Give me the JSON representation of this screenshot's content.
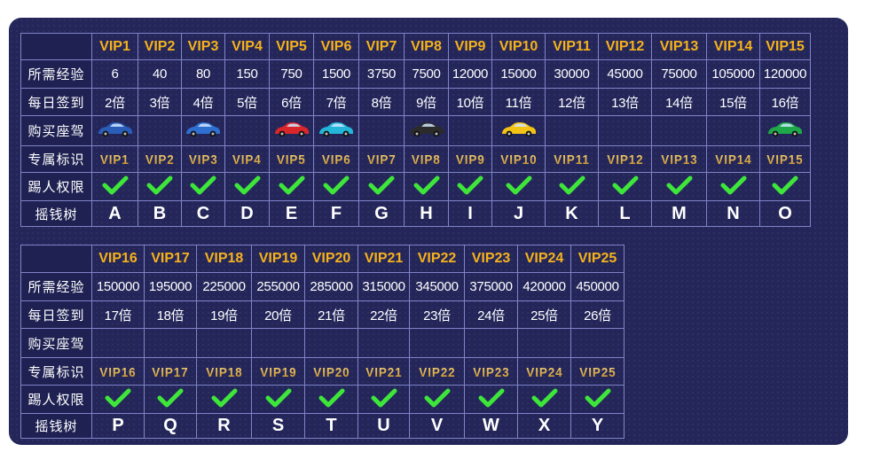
{
  "row_labels": {
    "exp": "所需经验",
    "sign": "每日签到",
    "car": "购买座驾",
    "badge": "专属标识",
    "kick": "踢人权限",
    "tree": "摇钱树"
  },
  "colors": {
    "panel": "#24265a",
    "grid": "#7e83c6",
    "level": "#f6b21b",
    "check": "#3ee63a"
  },
  "tier1": [
    {
      "level": "VIP1",
      "exp": "6",
      "sign": "2倍",
      "car": "blue-sedan",
      "badge": "VIP1",
      "kick": true,
      "tree": "A"
    },
    {
      "level": "VIP2",
      "exp": "40",
      "sign": "3倍",
      "car": "",
      "badge": "VIP2",
      "kick": true,
      "tree": "B"
    },
    {
      "level": "VIP3",
      "exp": "80",
      "sign": "4倍",
      "car": "blue-suv",
      "badge": "VIP3",
      "kick": true,
      "tree": "C"
    },
    {
      "level": "VIP4",
      "exp": "150",
      "sign": "5倍",
      "car": "",
      "badge": "VIP4",
      "kick": true,
      "tree": "D"
    },
    {
      "level": "VIP5",
      "exp": "750",
      "sign": "6倍",
      "car": "red-sports-car",
      "badge": "VIP5",
      "kick": true,
      "tree": "E"
    },
    {
      "level": "VIP6",
      "exp": "1500",
      "sign": "7倍",
      "car": "cyan-sports-car",
      "badge": "VIP6",
      "kick": true,
      "tree": "F"
    },
    {
      "level": "VIP7",
      "exp": "3750",
      "sign": "8倍",
      "car": "",
      "badge": "VIP7",
      "kick": true,
      "tree": "G"
    },
    {
      "level": "VIP8",
      "exp": "7500",
      "sign": "9倍",
      "car": "black-sedan",
      "badge": "VIP8",
      "kick": true,
      "tree": "H"
    },
    {
      "level": "VIP9",
      "exp": "12000",
      "sign": "10倍",
      "car": "",
      "badge": "VIP9",
      "kick": true,
      "tree": "I"
    },
    {
      "level": "VIP10",
      "exp": "15000",
      "sign": "11倍",
      "car": "yellow-supercar",
      "badge": "VIP10",
      "kick": true,
      "tree": "J"
    },
    {
      "level": "VIP11",
      "exp": "30000",
      "sign": "12倍",
      "car": "",
      "badge": "VIP11",
      "kick": true,
      "tree": "K"
    },
    {
      "level": "VIP12",
      "exp": "45000",
      "sign": "13倍",
      "car": "",
      "badge": "VIP12",
      "kick": true,
      "tree": "L"
    },
    {
      "level": "VIP13",
      "exp": "75000",
      "sign": "14倍",
      "car": "",
      "badge": "VIP13",
      "kick": true,
      "tree": "M"
    },
    {
      "level": "VIP14",
      "exp": "105000",
      "sign": "15倍",
      "car": "",
      "badge": "VIP14",
      "kick": true,
      "tree": "N"
    },
    {
      "level": "VIP15",
      "exp": "120000",
      "sign": "16倍",
      "car": "green-supercar",
      "badge": "VIP15",
      "kick": true,
      "tree": "O"
    }
  ],
  "tier2": [
    {
      "level": "VIP16",
      "exp": "150000",
      "sign": "17倍",
      "badge": "VIP16",
      "kick": true,
      "tree": "P"
    },
    {
      "level": "VIP17",
      "exp": "195000",
      "sign": "18倍",
      "badge": "VIP17",
      "kick": true,
      "tree": "Q"
    },
    {
      "level": "VIP18",
      "exp": "225000",
      "sign": "19倍",
      "badge": "VIP18",
      "kick": true,
      "tree": "R"
    },
    {
      "level": "VIP19",
      "exp": "255000",
      "sign": "20倍",
      "badge": "VIP19",
      "kick": true,
      "tree": "S"
    },
    {
      "level": "VIP20",
      "exp": "285000",
      "sign": "21倍",
      "badge": "VIP20",
      "kick": true,
      "tree": "T"
    },
    {
      "level": "VIP21",
      "exp": "315000",
      "sign": "22倍",
      "badge": "VIP21",
      "kick": true,
      "tree": "U"
    },
    {
      "level": "VIP22",
      "exp": "345000",
      "sign": "23倍",
      "badge": "VIP22",
      "kick": true,
      "tree": "V"
    },
    {
      "level": "VIP23",
      "exp": "375000",
      "sign": "24倍",
      "badge": "VIP23",
      "kick": true,
      "tree": "W"
    },
    {
      "level": "VIP24",
      "exp": "420000",
      "sign": "25倍",
      "badge": "VIP24",
      "kick": true,
      "tree": "X"
    },
    {
      "level": "VIP25",
      "exp": "450000",
      "sign": "26倍",
      "badge": "VIP25",
      "kick": true,
      "tree": "Y"
    }
  ]
}
